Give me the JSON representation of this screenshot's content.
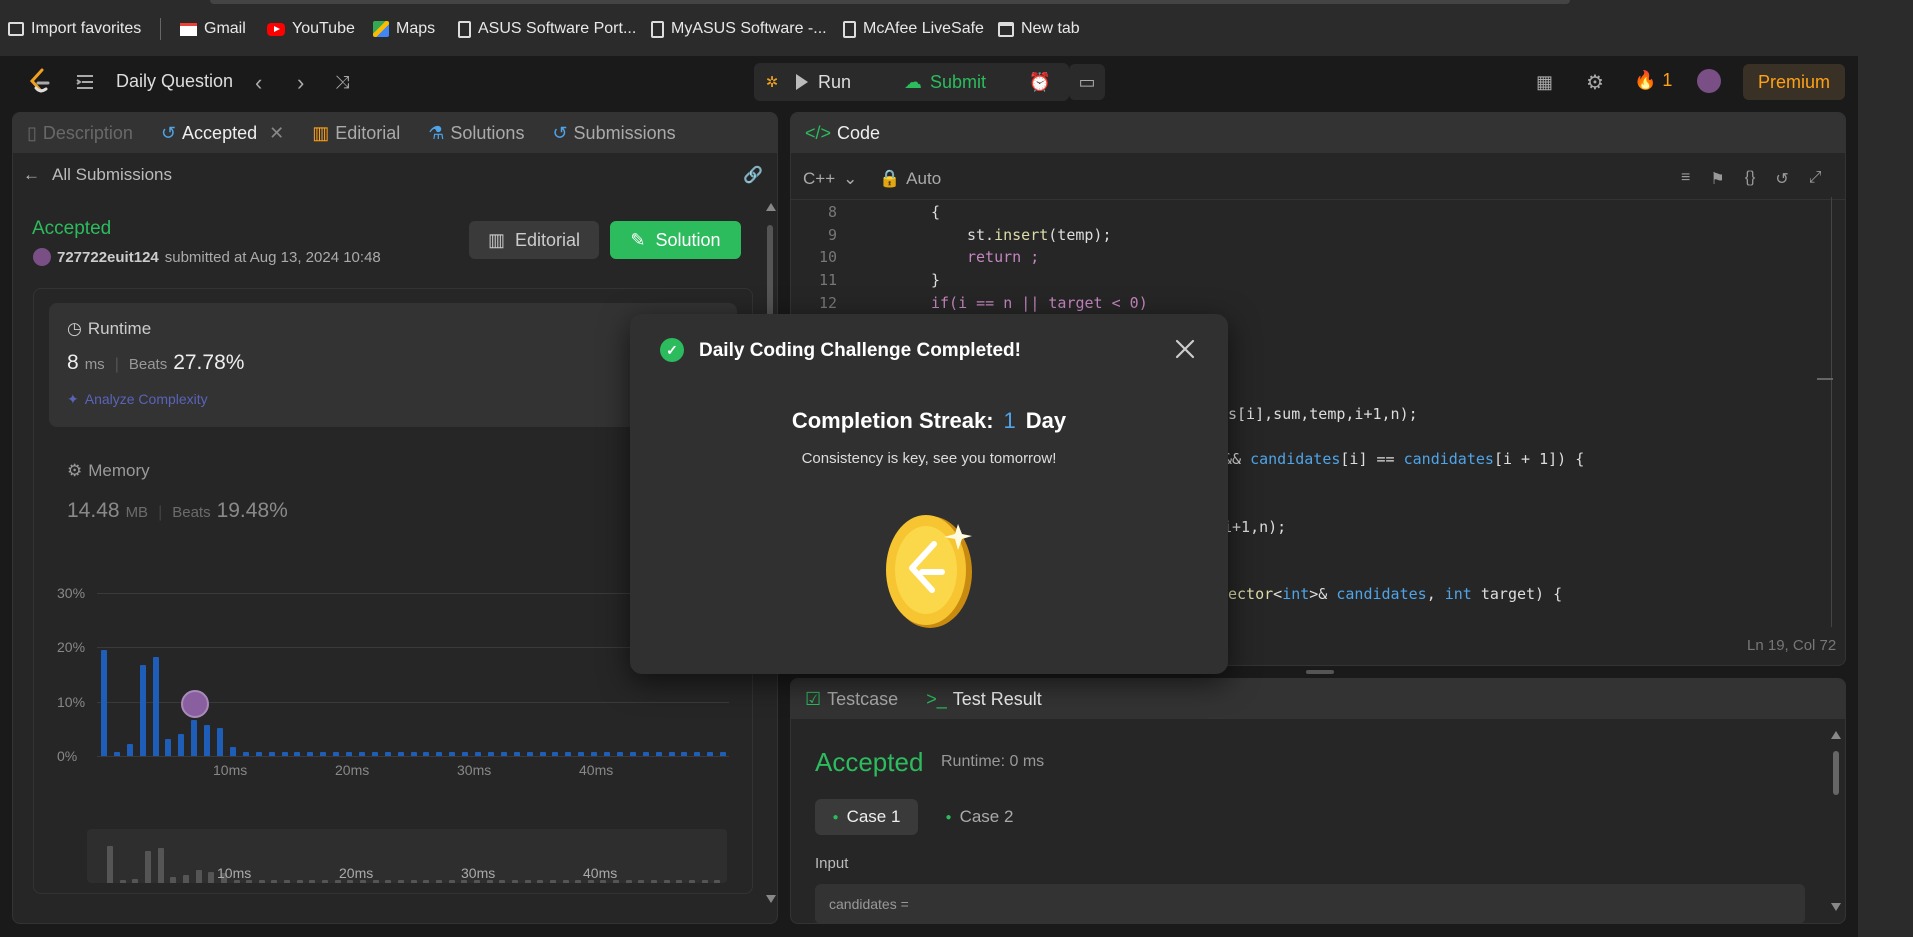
{
  "bookmarks": [
    {
      "label": "Import favorites",
      "icon": "import-icon"
    },
    {
      "label": "Gmail",
      "icon": "gmail-icon"
    },
    {
      "label": "YouTube",
      "icon": "youtube-icon"
    },
    {
      "label": "Maps",
      "icon": "maps-icon"
    },
    {
      "label": "ASUS Software Port...",
      "icon": "page-icon"
    },
    {
      "label": "MyASUS Software -...",
      "icon": "page-icon"
    },
    {
      "label": "McAfee LiveSafe",
      "icon": "page-icon"
    },
    {
      "label": "New tab",
      "icon": "newtab-icon"
    }
  ],
  "nav": {
    "title": "Daily Question",
    "run": "Run",
    "submit": "Submit",
    "streak_count": "1",
    "premium": "Premium"
  },
  "left_panel": {
    "tabs": [
      "Description",
      "Accepted",
      "Editorial",
      "Solutions",
      "Submissions"
    ],
    "back": "All Submissions",
    "status": "Accepted",
    "user": "727722euit124",
    "submitted_text": "submitted at Aug 13, 2024 10:48",
    "editorial_btn": "Editorial",
    "solution_btn": "Solution",
    "runtime_label": "Runtime",
    "runtime_value": "8",
    "runtime_unit": "ms",
    "beats_label": "Beats",
    "runtime_beats": "27.78%",
    "analyze": "Analyze Complexity",
    "memory_label": "Memory",
    "memory_value": "14.48",
    "memory_unit": "MB",
    "memory_beats": "19.48%",
    "next_text": "Code | C++"
  },
  "chart_data": {
    "type": "bar",
    "y_ticks": [
      "30%",
      "20%",
      "10%",
      "0%"
    ],
    "x_ticks": [
      "10ms",
      "20ms",
      "30ms",
      "40ms"
    ],
    "ylim": [
      0,
      30
    ],
    "values": [
      19.5,
      0.8,
      2.2,
      16.7,
      18.2,
      3.2,
      4.1,
      6.6,
      5.8,
      5.2,
      1.7,
      0.8,
      0.8,
      0.8,
      0.8,
      0.8,
      0.8,
      0.8,
      0.8,
      0.8,
      0.8,
      0.8,
      0.8,
      0.8,
      0.8,
      0.8,
      0.8,
      0.8,
      0.8,
      0.8,
      0.8,
      0.8,
      0.8,
      0.8,
      0.8,
      0.8,
      0.8,
      0.8,
      0.8,
      0.8,
      0.8,
      0.8,
      0.8,
      0.8,
      0.8,
      0.8,
      0.8,
      0.8,
      0.8
    ]
  },
  "code_panel": {
    "title": "Code",
    "lang": "C++",
    "mode": "Auto",
    "cursor": "Ln 19, Col 72",
    "lines": [
      {
        "n": "8",
        "text": "{"
      },
      {
        "n": "9",
        "text": "st.insert(temp);"
      },
      {
        "n": "10",
        "text": "return ;"
      },
      {
        "n": "11",
        "text": "}"
      },
      {
        "n": "12",
        "text": "if(i == n || target < 0)"
      }
    ],
    "hidden_fragments": [
      "s[i],sum,temp,i+1,n);",
      "&& candidates[i] == candidates[i + 1]) {",
      "i+1,n);",
      "ector<int>& candidates, int target) {"
    ]
  },
  "result_panel": {
    "tab_testcase": "Testcase",
    "tab_result": "Test Result",
    "status": "Accepted",
    "runtime": "Runtime: 0 ms",
    "case1": "Case 1",
    "case2": "Case 2",
    "input_label": "Input",
    "input_value": "candidates ="
  },
  "modal": {
    "title": "Daily Coding Challenge Completed!",
    "streak_label": "Completion Streak:",
    "streak_value": "1",
    "streak_unit": "Day",
    "message": "Consistency is key, see you tomorrow!"
  },
  "colors": {
    "accent_green": "#2cbb5d",
    "accent_blue": "#1e5eb8",
    "premium": "#ffa116"
  }
}
